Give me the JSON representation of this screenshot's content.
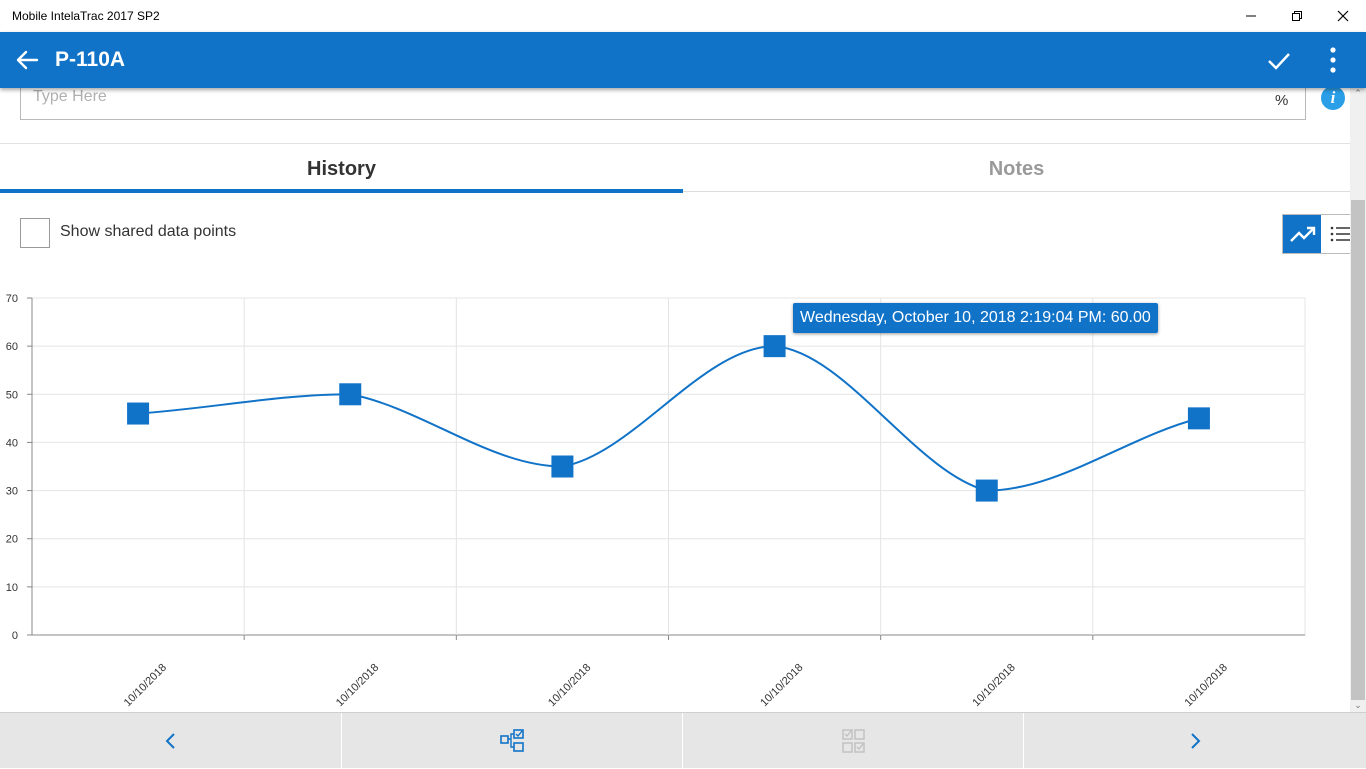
{
  "window": {
    "title": "Mobile IntelaTrac 2017 SP2"
  },
  "appbar": {
    "title": "P-110A"
  },
  "entry": {
    "placeholder": "Type Here",
    "unit": "%"
  },
  "tabs": [
    {
      "label": "History",
      "active": true
    },
    {
      "label": "Notes",
      "active": false
    }
  ],
  "options": {
    "shared_label": "Show shared data points",
    "shared_checked": false
  },
  "tooltip": {
    "text": "Wednesday, October 10, 2018 2:19:04 PM: 60.00"
  },
  "colors": {
    "accent": "#1173c8",
    "info": "#2a9ee6"
  },
  "chart_data": {
    "type": "line",
    "categories": [
      "10/10/2018",
      "10/10/2018",
      "10/10/2018",
      "10/10/2018",
      "10/10/2018",
      "10/10/2018"
    ],
    "series": [
      {
        "values": [
          46,
          50,
          35,
          60,
          30,
          45
        ]
      }
    ],
    "ylim": [
      0,
      70
    ],
    "yticks": [
      0,
      10,
      20,
      30,
      40,
      50,
      60,
      70
    ],
    "grid": true,
    "smooth": true,
    "marker": "square"
  },
  "bottom_nav": [
    {
      "icon": "chevron-left-icon"
    },
    {
      "icon": "hierarchy-icon"
    },
    {
      "icon": "checklist-icon"
    },
    {
      "icon": "chevron-right-icon"
    }
  ]
}
